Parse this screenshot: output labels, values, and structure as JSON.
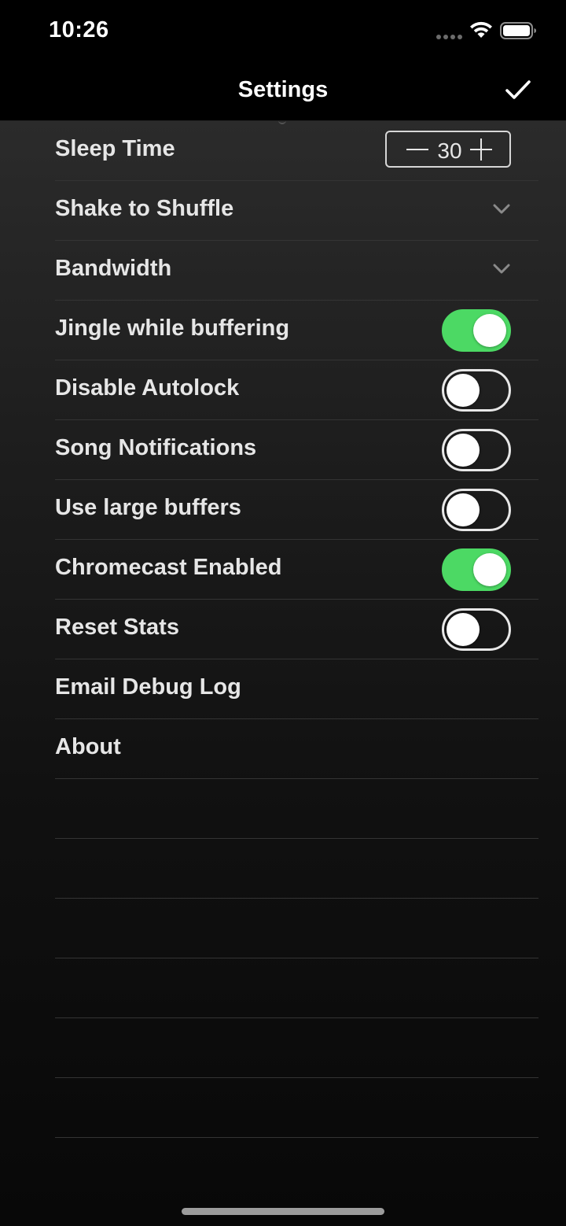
{
  "status_bar": {
    "time": "10:26"
  },
  "nav": {
    "title": "Settings",
    "done_icon": "checkmark-icon"
  },
  "settings": {
    "sleep_time": {
      "label": "Sleep Time",
      "value": "30"
    },
    "shake_to_shuffle": {
      "label": "Shake to Shuffle"
    },
    "bandwidth": {
      "label": "Bandwidth"
    },
    "jingle_while_buffering": {
      "label": "Jingle while buffering",
      "enabled": true
    },
    "disable_autolock": {
      "label": "Disable Autolock",
      "enabled": false
    },
    "song_notifications": {
      "label": "Song Notifications",
      "enabled": false
    },
    "use_large_buffers": {
      "label": "Use large buffers",
      "enabled": false
    },
    "chromecast_enabled": {
      "label": "Chromecast Enabled",
      "enabled": true
    },
    "reset_stats": {
      "label": "Reset Stats",
      "enabled": false
    },
    "email_debug_log": {
      "label": "Email Debug Log"
    },
    "about": {
      "label": "About"
    }
  },
  "colors": {
    "toggle_on": "#4cd964",
    "background": "#000000",
    "separator": "#343434"
  }
}
